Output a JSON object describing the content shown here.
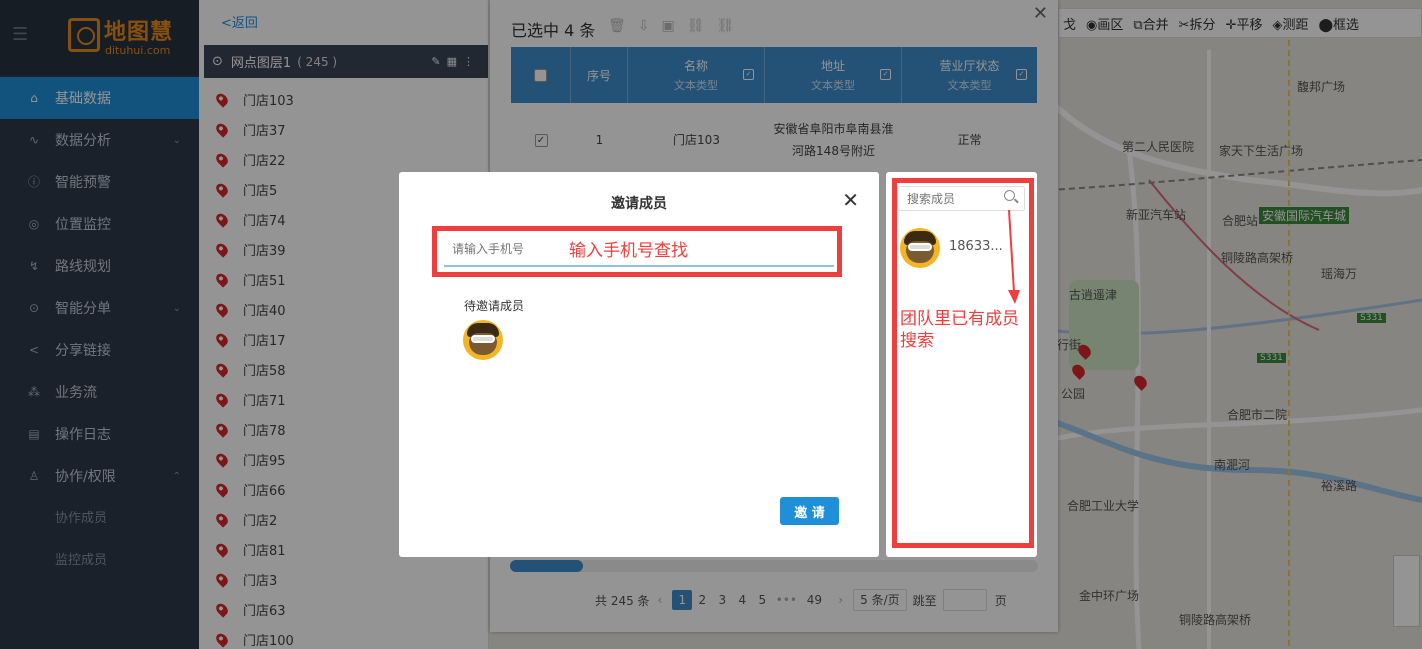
{
  "app": {
    "logo_name": "地图慧",
    "logo_domain": "dituhui.com"
  },
  "sidebar": {
    "items": [
      {
        "label": "基础数据",
        "icon": "home-icon",
        "active": true
      },
      {
        "label": "数据分析",
        "icon": "chart-icon",
        "chevron": "down"
      },
      {
        "label": "智能预警",
        "icon": "info-icon"
      },
      {
        "label": "位置监控",
        "icon": "location-icon"
      },
      {
        "label": "路线规划",
        "icon": "route-icon"
      },
      {
        "label": "智能分单",
        "icon": "pin-icon",
        "chevron": "down"
      },
      {
        "label": "分享链接",
        "icon": "share-icon"
      },
      {
        "label": "业务流",
        "icon": "workflow-icon"
      },
      {
        "label": "操作日志",
        "icon": "log-icon"
      },
      {
        "label": "协作/权限",
        "icon": "user-icon",
        "chevron": "up"
      }
    ],
    "subitems": [
      {
        "label": "协作成员"
      },
      {
        "label": "监控成员"
      }
    ]
  },
  "layer_panel": {
    "back_label": "<返回",
    "title": "网点图层1",
    "count": "( 245 )",
    "stores": [
      "门店103",
      "门店37",
      "门店22",
      "门店5",
      "门店74",
      "门店39",
      "门店51",
      "门店40",
      "门店17",
      "门店58",
      "门店71",
      "门店78",
      "门店95",
      "门店66",
      "门店2",
      "门店81",
      "门店3",
      "门店63",
      "门店100"
    ]
  },
  "map": {
    "toolbar": [
      "戈",
      "◉画区",
      "⧉合并",
      "✂拆分",
      "✛平移",
      "◈测距",
      "⬤框选"
    ],
    "labels": [
      "馥邦广场",
      "第二人民医院",
      "家天下生活广场",
      "新亚汽车站",
      "合肥站",
      "安徽国际汽车城",
      "铜陵路高架桥",
      "瑶海万",
      "古逍遥津",
      "S331",
      "S331",
      "行街",
      "公园",
      "合肥市二院",
      "南淝河",
      "合肥工业大学",
      "裕溪路",
      "金中环广场",
      "铜陵路高架桥"
    ]
  },
  "table_dialog": {
    "title": "已选中 4 条",
    "columns": [
      {
        "name": "序号"
      },
      {
        "name": "名称",
        "type": "文本类型"
      },
      {
        "name": "地址",
        "type": "文本类型"
      },
      {
        "name": "营业厅状态",
        "type": "文本类型"
      }
    ],
    "row": {
      "index": "1",
      "name": "门店103",
      "address_line1": "安徽省阜阳市阜南县淮",
      "address_line2": "河路148号附近",
      "status": "正常"
    },
    "pager": {
      "total": "共 245 条",
      "pages": [
        "1",
        "2",
        "3",
        "4",
        "5",
        "•••",
        "49"
      ],
      "page_size": "5 条/页",
      "jump_label": "跳至",
      "page_suffix": "页"
    }
  },
  "invite_modal": {
    "title": "邀请成员",
    "phone_placeholder": "请输入手机号",
    "phone_annotation": "输入手机号查找",
    "pending_label": "待邀请成员",
    "invite_button": "邀 请"
  },
  "members_panel": {
    "search_placeholder": "搜索成员",
    "member_name": "18633...",
    "annotation": "团队里已有成员搜索"
  },
  "colors": {
    "accent": "#1f8fd8",
    "annotation_red": "#ef3e3e",
    "sidebar_bg": "#2d3a4b"
  }
}
